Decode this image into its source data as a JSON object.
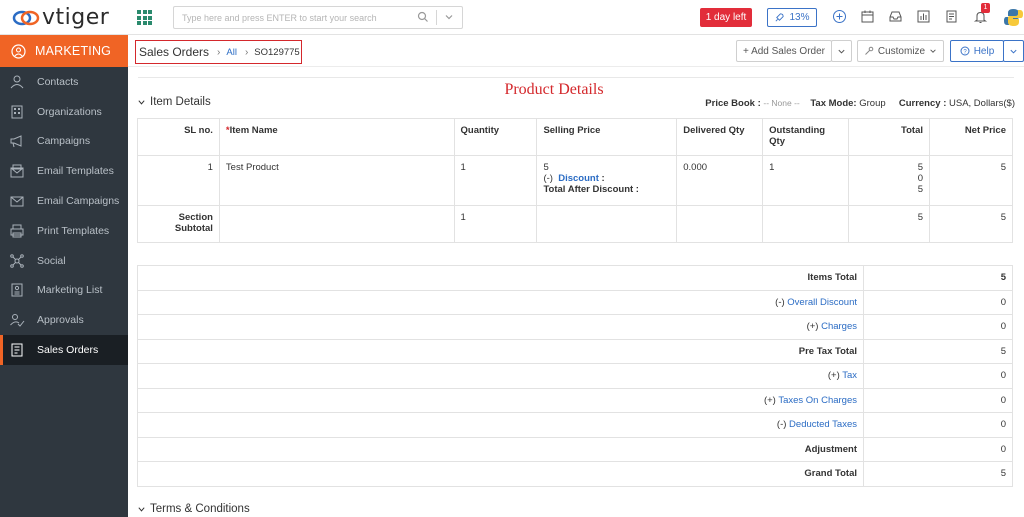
{
  "app": {
    "brand": "vtiger"
  },
  "search": {
    "placeholder": "Type here and press ENTER to start your search"
  },
  "topbar": {
    "trial_label": "1 day left",
    "rocket_label": "13%",
    "notification_count": "1",
    "icons": [
      "apps-grid-icon",
      "search-icon",
      "chevron-down-icon",
      "rocket-icon",
      "plus-circle-icon",
      "calendar-icon",
      "inbox-icon",
      "reports-icon",
      "notes-icon",
      "bell-icon",
      "avatar"
    ]
  },
  "sidebar": {
    "module": "MARKETING",
    "items": [
      {
        "label": "Contacts",
        "icon": "person-icon"
      },
      {
        "label": "Organizations",
        "icon": "building-icon"
      },
      {
        "label": "Campaigns",
        "icon": "megaphone-icon"
      },
      {
        "label": "Email Templates",
        "icon": "email-template-icon"
      },
      {
        "label": "Email Campaigns",
        "icon": "envelope-icon"
      },
      {
        "label": "Print Templates",
        "icon": "printer-icon"
      },
      {
        "label": "Social",
        "icon": "social-icon"
      },
      {
        "label": "Marketing List",
        "icon": "list-icon"
      },
      {
        "label": "Approvals",
        "icon": "approval-icon"
      },
      {
        "label": "Sales Orders",
        "icon": "sales-order-icon",
        "active": true
      }
    ]
  },
  "header": {
    "breadcrumb_title": "Sales Orders",
    "breadcrumb_all": "All",
    "breadcrumb_id": "SO129775",
    "add_label": "+ Add Sales Order",
    "customize_label": "Customize",
    "help_label": "Help"
  },
  "content": {
    "product_details_title": "Product Details",
    "item_details_label": "Item Details",
    "price_book_label": "Price Book :",
    "price_book_value": "-- None --",
    "tax_mode_label": "Tax Mode:",
    "tax_mode_value": "Group",
    "currency_label": "Currency :",
    "currency_value": "USA, Dollars($)",
    "terms_label": "Terms & Conditions"
  },
  "items_table": {
    "headers": {
      "sl": "SL no.",
      "req_mark": "*",
      "item_name": "Item Name",
      "quantity": "Quantity",
      "selling_price": "Selling Price",
      "delivered_qty": "Delivered Qty",
      "outstanding_qty": "Outstanding Qty",
      "total": "Total",
      "net_price": "Net Price"
    },
    "row": {
      "sl": "1",
      "item_name": "Test Product",
      "quantity": "1",
      "selling_price": "5",
      "discount_prefix": "(-)",
      "discount_label": "Discount",
      "discount_colon": ":",
      "total_after_discount": "Total After Discount :",
      "delivered_qty": "0.000",
      "outstanding_qty": "1",
      "total_lines": [
        "5",
        "0",
        "5"
      ],
      "net_price": "5"
    },
    "subtotal": {
      "label": "Section Subtotal",
      "quantity": "1",
      "total": "5",
      "net_price": "5"
    }
  },
  "totals": [
    {
      "prefix": "",
      "label": "Items Total",
      "link": false,
      "bold": true,
      "value": "5",
      "value_bold": true
    },
    {
      "prefix": "(-)",
      "label": "Overall Discount",
      "link": true,
      "bold": false,
      "value": "0"
    },
    {
      "prefix": "(+)",
      "label": "Charges",
      "link": true,
      "bold": false,
      "value": "0"
    },
    {
      "prefix": "",
      "label": "Pre Tax Total",
      "link": false,
      "bold": true,
      "value": "5"
    },
    {
      "prefix": "(+)",
      "label": "Tax",
      "link": true,
      "bold": false,
      "value": "0"
    },
    {
      "prefix": "(+)",
      "label": "Taxes On Charges",
      "link": true,
      "bold": false,
      "value": "0"
    },
    {
      "prefix": "(-)",
      "label": "Deducted Taxes",
      "link": true,
      "bold": false,
      "value": "0"
    },
    {
      "prefix": "",
      "label": "Adjustment",
      "link": false,
      "bold": true,
      "value": "0"
    },
    {
      "prefix": "",
      "label": "Grand Total",
      "link": false,
      "bold": true,
      "value": "5"
    }
  ],
  "colors": {
    "accent_orange": "#f06425",
    "sidebar_bg": "#2f373f",
    "link_blue": "#2b6cc4",
    "alert_red": "#e22d3a",
    "highlight_red": "#d4282c"
  }
}
